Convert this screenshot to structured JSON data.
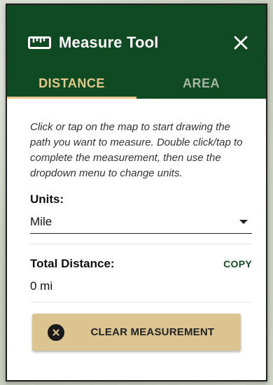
{
  "panel": {
    "title": "Measure Tool",
    "icons": {
      "title_icon": "ruler-icon",
      "close_icon": "close-icon",
      "clear_icon": "clear-circle-icon"
    },
    "colors": {
      "header_bg": "#0f4a23",
      "accent": "#e2c88a",
      "button_bg": "#dcc490",
      "inactive_tab": "#a7b6a3"
    }
  },
  "tabs": [
    {
      "label": "DISTANCE",
      "active": true
    },
    {
      "label": "AREA",
      "active": false
    }
  ],
  "instructions": "Click or tap on the map to start drawing the path you want to measure. Double click/tap to complete the measurement, then use the dropdown menu to change units.",
  "units": {
    "label": "Units:",
    "selected": "Mile"
  },
  "total": {
    "label": "Total Distance:",
    "copy_label": "COPY",
    "value": "0 mi"
  },
  "clear_button": {
    "label": "CLEAR MEASUREMENT"
  }
}
